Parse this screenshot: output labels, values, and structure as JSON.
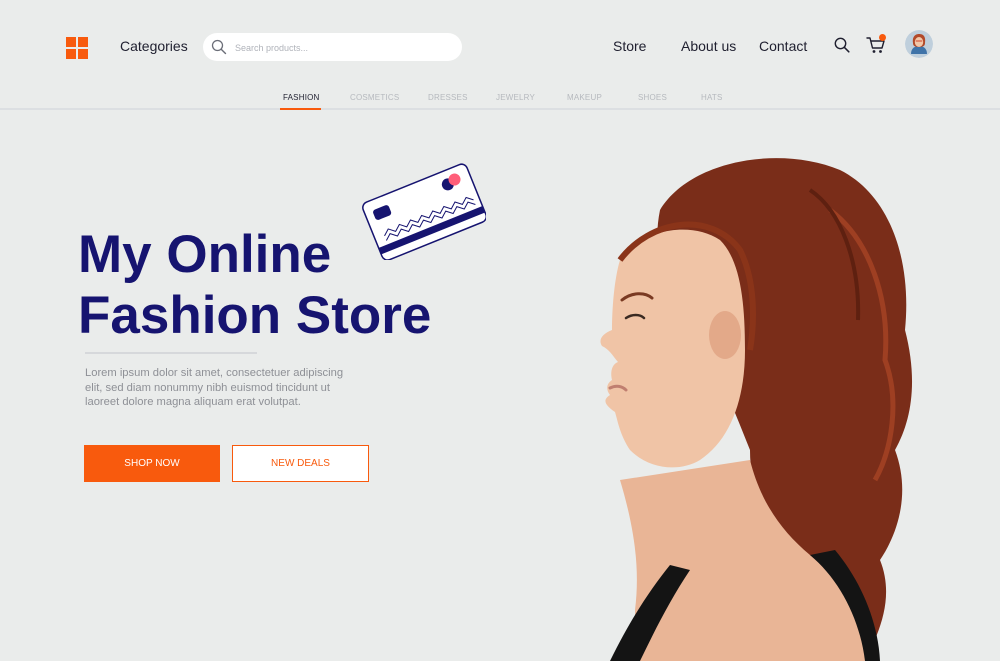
{
  "header": {
    "categories_label": "Categories",
    "search_placeholder": "Search products...",
    "nav": {
      "store": "Store",
      "about": "About us",
      "contact": "Contact"
    },
    "cart_has_notification": true
  },
  "tabs": [
    {
      "label": "FASHION",
      "active": true
    },
    {
      "label": "COSMETICS",
      "active": false
    },
    {
      "label": "DRESSES",
      "active": false
    },
    {
      "label": "JEWELRY",
      "active": false
    },
    {
      "label": "MAKEUP",
      "active": false
    },
    {
      "label": "SHOES",
      "active": false
    },
    {
      "label": "HATS",
      "active": false
    }
  ],
  "hero": {
    "title_line1": "My Online",
    "title_line2": "Fashion Store",
    "description": "Lorem ipsum dolor sit amet, consectetuer adipiscing elit, sed diam nonummy nibh euismod tincidunt ut laoreet dolore magna aliquam erat volutpat.",
    "primary_button": "SHOP NOW",
    "secondary_button": "NEW DEALS"
  },
  "icons": {
    "logo": "logo-grid-icon",
    "search": "search-icon",
    "cart": "shopping-cart-icon",
    "card": "credit-card-icon"
  },
  "colors": {
    "accent": "#f85a0d",
    "title": "#161470",
    "background": "#eaeceb"
  }
}
